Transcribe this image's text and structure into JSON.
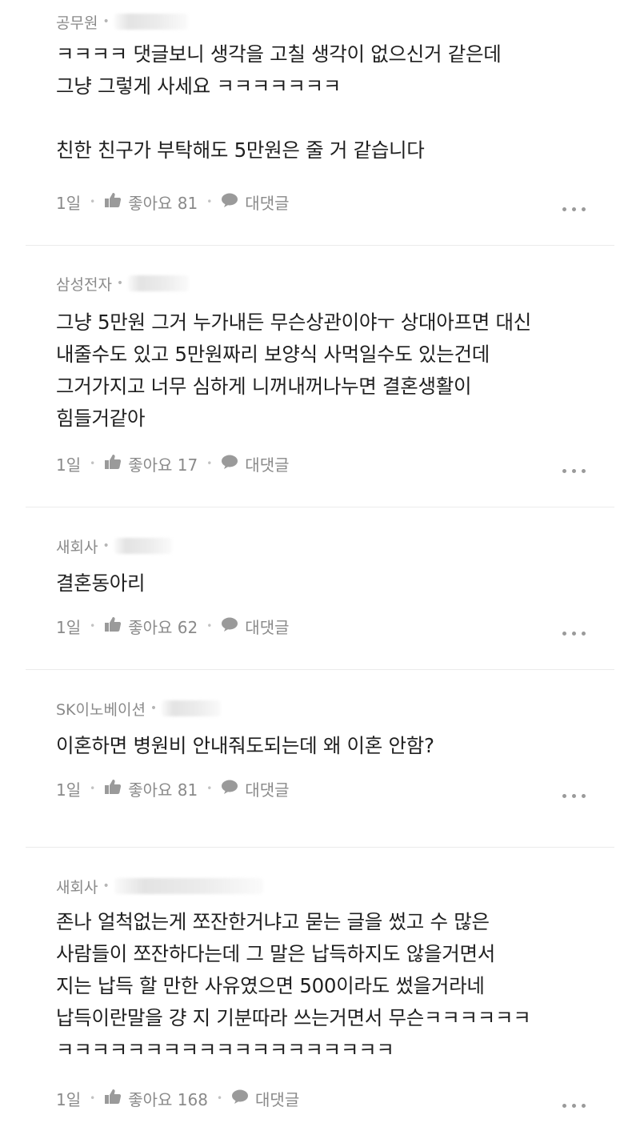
{
  "comments": [
    {
      "company": "공무원",
      "lines": [
        "ㅋㅋㅋㅋ 댓글보니 생각을 고칠 생각이 없으신거 같은데",
        "그냥 그렇게 사세요 ㅋㅋㅋㅋㅋㅋㅋ",
        "",
        "친한 친구가 부탁해도 5만원은 줄 거 같습니다"
      ],
      "time": "1일",
      "like_label": "좋아요 81",
      "reply_label": "대댓글"
    },
    {
      "company": "삼성전자",
      "lines": [
        "그냥 5만원 그거 누가내든 무슨상관이야ㅜ 상대아프면 대신",
        "내줄수도 있고 5만원짜리 보양식 사먹일수도 있는건데",
        "그거가지고 너무 심하게 니꺼내꺼나누면 결혼생활이",
        "힘들거같아"
      ],
      "time": "1일",
      "like_label": "좋아요 17",
      "reply_label": "대댓글"
    },
    {
      "company": "새회사",
      "lines": [
        "결혼동아리"
      ],
      "time": "1일",
      "like_label": "좋아요 62",
      "reply_label": "대댓글"
    },
    {
      "company": "SK이노베이션",
      "lines": [
        "이혼하면 병원비 안내줘도되는데 왜 이혼 안함?"
      ],
      "time": "1일",
      "like_label": "좋아요 81",
      "reply_label": "대댓글"
    },
    {
      "company": "새회사",
      "lines": [
        "존나 얼척없는게 쪼잔한거냐고 묻는 글을 썼고 수 많은",
        "사람들이 쪼잔하다는데 그 말은 납득하지도 않을거면서",
        "지는 납득 할 만한 사유였으면 500이라도 썼을거라네",
        "납득이란말을 걍 지 기분따라 쓰는거면서 무슨ㅋㅋㅋㅋㅋㅋ",
        "ㅋㅋㅋㅋㅋㅋㅋㅋㅋㅋㅋㅋㅋㅋㅋㅋㅋㅋㅋ"
      ],
      "time": "1일",
      "like_label": "좋아요 168",
      "reply_label": "대댓글"
    }
  ],
  "icons": {
    "like": "thumbs-up-icon",
    "reply": "speech-bubble-icon",
    "more": "more-dots-icon"
  },
  "colors": {
    "text": "#1f1f1f",
    "meta": "#8a8a8a",
    "divider": "#ebebeb"
  }
}
